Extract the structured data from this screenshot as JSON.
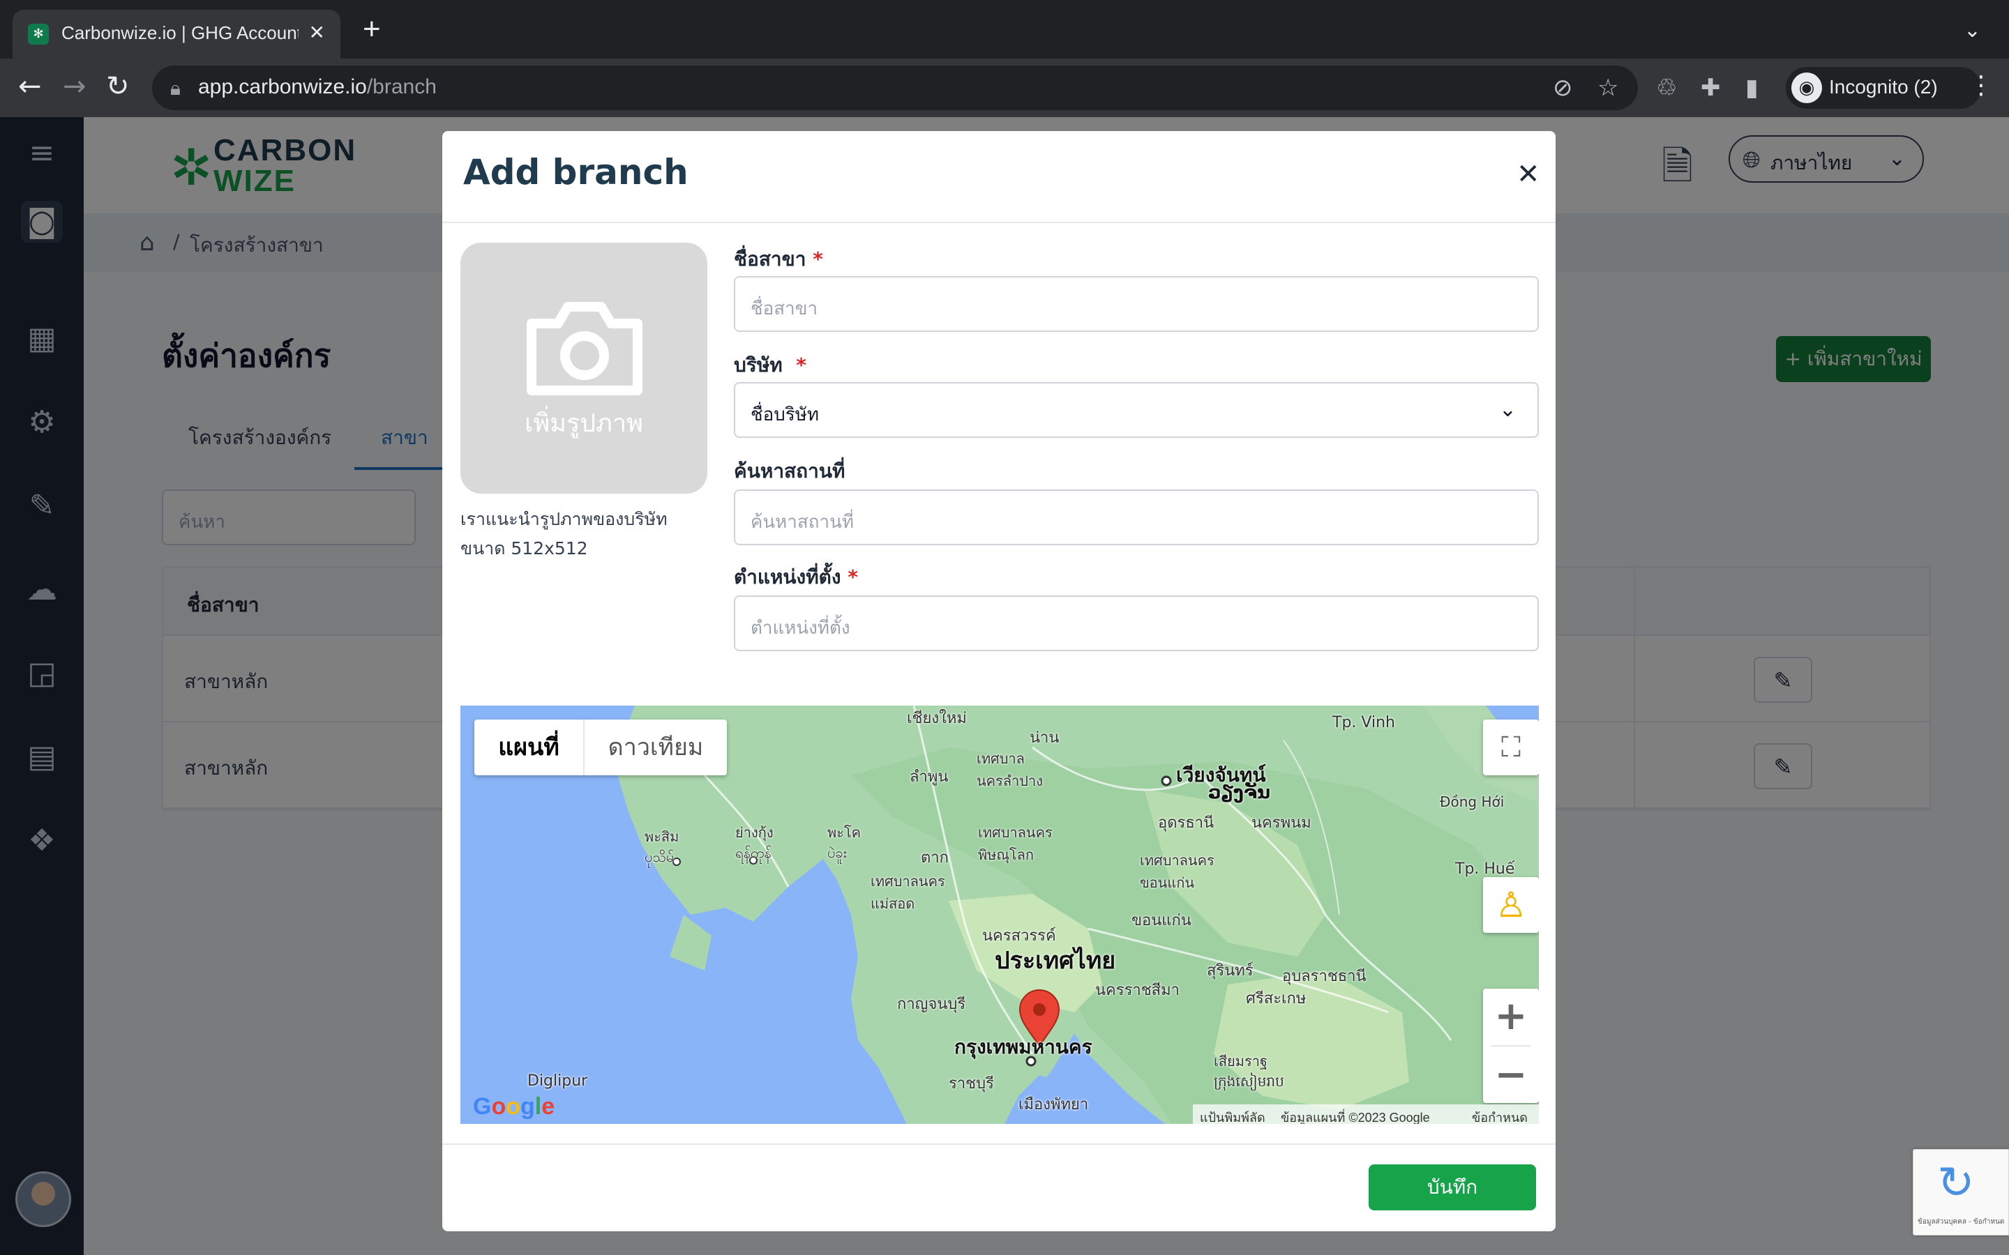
{
  "browser": {
    "tab_title": "Carbonwize.io | GHG Accounting",
    "url_host": "app.carbonwize.io",
    "url_path": "/branch",
    "profile_label": "Incognito (2)",
    "icons": [
      "back-icon",
      "forward-icon",
      "reload-icon",
      "lock-icon",
      "eye-off-icon",
      "star-icon",
      "recycle-icon",
      "puzzle-icon",
      "sidepanel-icon",
      "incognito-icon",
      "menu-icon"
    ]
  },
  "app": {
    "logo_line1": "CARBON",
    "logo_line2": "WIZE",
    "language": "ภาษาไทย",
    "brand_color": "#16a34a",
    "sidebar_icons": [
      "menu-icon",
      "camera-icon",
      "layout-icon",
      "gear-icon",
      "edit-icon",
      "cloud-icon",
      "report-icon",
      "clipboard-icon",
      "components-icon"
    ]
  },
  "breadcrumb": {
    "separator": "/",
    "current": "โครงสร้างสาขา"
  },
  "page": {
    "title": "ตั้งค่าองค์กร",
    "add_button": "+ เพิ่มสาขาใหม่",
    "tabs": [
      {
        "label": "โครงสร้างองค์กร"
      },
      {
        "label": "สาขา"
      }
    ],
    "search_placeholder": "ค้นหา",
    "table": {
      "header": "ชื่อสาขา",
      "rows": [
        {
          "name": "สาขาหลัก"
        },
        {
          "name": "สาขาหลัก"
        }
      ]
    }
  },
  "modal": {
    "title": "Add branch",
    "image_upload_label": "เพิ่มรูปภาพ",
    "image_hint_line1": "เราแนะนำรูปภาพของบริษัท",
    "image_hint_line2": "ขนาด 512x512",
    "fields": {
      "branch_name": {
        "label": "ชื่อสาขา",
        "required": "*",
        "placeholder": "ชื่อสาขา"
      },
      "company": {
        "label": "บริษัท",
        "required": "*",
        "value": "ชื่อบริษัท"
      },
      "place_search": {
        "label": "ค้นหาสถานที่",
        "placeholder": "ค้นหาสถานที่"
      },
      "location": {
        "label": "ตำแหน่งที่ตั้ง",
        "required": "*",
        "placeholder": "ตำแหน่งที่ตั้ง"
      }
    },
    "map": {
      "type_map": "แผนที่",
      "type_satellite": "ดาวเทียม",
      "labels": {
        "chiang_mai": "เชียงใหม่",
        "nan": "น่าน",
        "lamphun": "ลำพูน",
        "lampang": "เทศบาล\nนครลำปาง",
        "vientiane": "เวียงจันทน์",
        "vientiane2": "ວຽງຈັນ",
        "udon": "อุดรธานี",
        "nakhon_phanom": "นครพนม",
        "dong_hoi": "Đồng Hới",
        "vinh": "Tp. Vinh",
        "hue": "Tp. Huế",
        "khon_kaen": "เทศบาลนคร\nขอนแก่น",
        "khon_kaen2": "ขอนแก่น",
        "phitsanulok": "เทศบาลนคร\nพิษณุโลก",
        "tak": "ตาก",
        "mae_sot": "เทศบาลนคร\nแม่สอด",
        "yangon": "ย่างกุ้ง\nရန်ကုန်",
        "pathein": "พะสิม\nပုသိမ်",
        "bago": "พะโค\nပဲခူး",
        "nakhon_sawan": "นครสวรรค์",
        "country": "ประเทศไทย",
        "surin": "สุรินทร์",
        "ubon": "อุบลราชธานี",
        "sisaket": "ศรีสะเกษ",
        "korat": "นครราชสีมา",
        "kanchanaburi": "กาญจนบุรี",
        "bangkok": "กรุงเทพมหานคร",
        "ratchaburi": "ราชบุรี",
        "pattaya": "เมืองพัทยา",
        "siem_reap": "เสียมราฐ\nក្រុងសៀមរាប",
        "diglipur": "Diglipur"
      },
      "footer_shortcuts": "แป้นพิมพ์ลัด",
      "footer_data": "ข้อมูลแผนที่ ©2023 Google",
      "footer_terms": "ข้อกำหนด",
      "google": "Google"
    },
    "save_button": "บันทึก"
  },
  "recaptcha": {
    "text": "ข้อมูลส่วนบุคคล - ข้อกำหนด"
  }
}
